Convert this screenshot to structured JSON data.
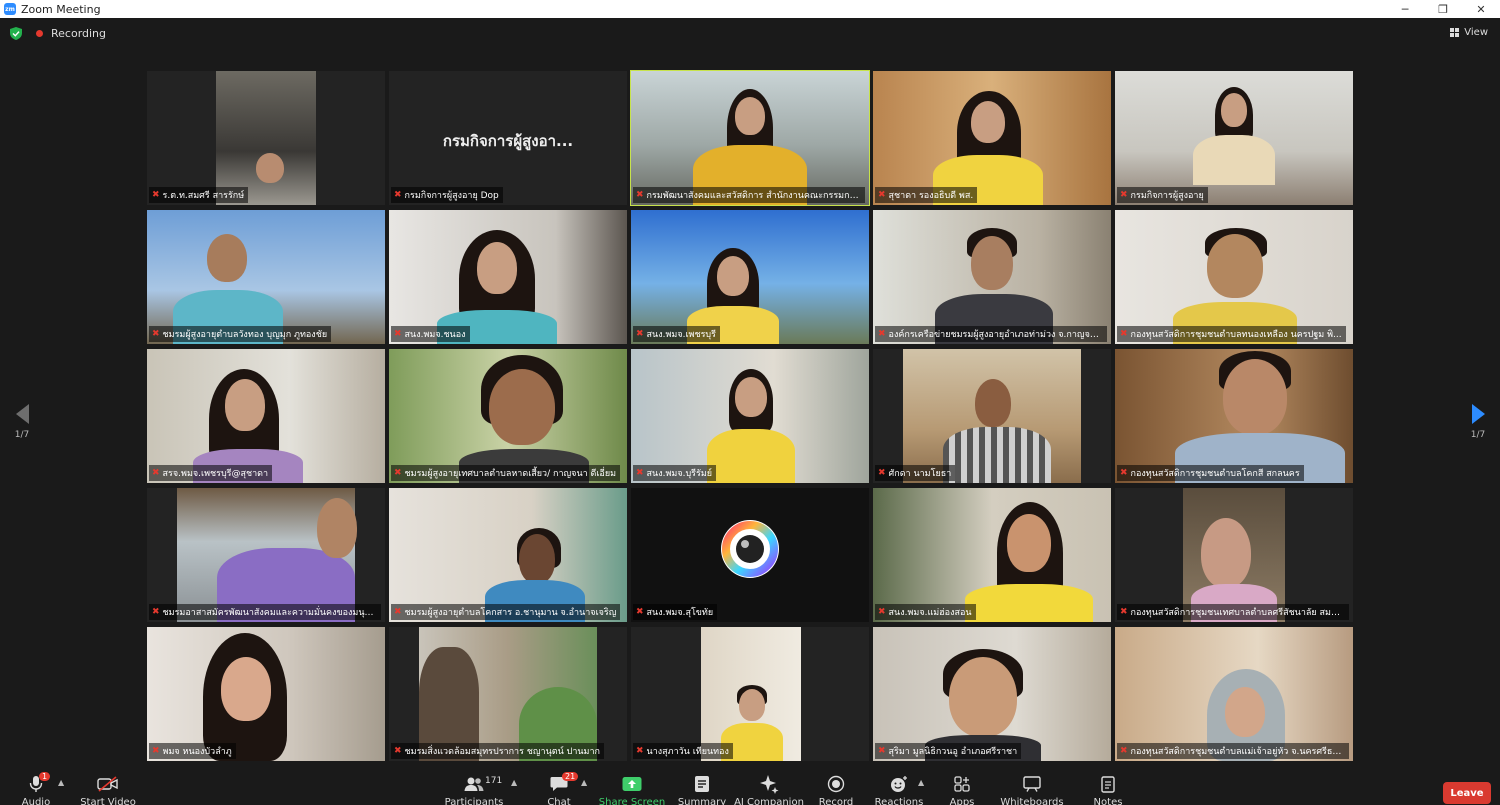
{
  "window": {
    "title": "Zoom Meeting",
    "minimize": "─",
    "maximize": "❐",
    "close": "✕"
  },
  "status": {
    "recording": "Recording",
    "view": "View"
  },
  "pager": {
    "left": "1/7",
    "right": "1/7"
  },
  "tiles": [
    "ร.ต.ท.สมศรี สารรักษ์",
    "กรมกิจการผู้สูงอายุ Dop",
    "กรมพัฒนาสังคมและสวัสดิการ สำนักงานคณะกรรมการส่งเ...",
    "สุชาดา รองอธิบดี พส.",
    "กรมกิจการผู้สูงอายุ",
    "ชมรมผู้สูงอายุตำบลวังทอง บุญมุก ภูทองชัย",
    "สนง.พมจ.ชนอง",
    "สนง.พมจ.เพชรบุรี",
    "องค์กรเครือข่ายชมรมผู้สูงอายุอำเภอท่าม่วง จ.กาญจนบุรี",
    "กองทุนสวัสดิการชุมชนตำบลทนองเหลือง นครปฐม พิ...",
    "สรจ.พมจ.เพชรบุรี@สุชาดา",
    "ชมรมผู้สูงอายุเทศบาลตำบลหาดเสี้ยว/ กาญจนา ดีเอี่ยม",
    "สนง.พมจ.บุรีรัมย์",
    "ศักดา นามโยธา",
    "กองทุนสวัสดิการชุมชนตำบลโคกสี สกลนคร",
    "ชมรมอาสาสมัครพัฒนาสังคมและความมั่นคงของมนุษย์ ...",
    "ชมรมผู้สูงอายุตำบลโคกสาร อ.ชานุมาน จ.อำนาจเจริญ",
    "สนง.พมจ.สุโขทัย",
    "สนง.พมจ.แม่ฮ่องสอน",
    "กองทุนสวัสดิการชุมชนเทศบาลตำบลศรีสัชนาลัย สมพร ผ...",
    "พมจ หนองบัวลำภู",
    "ชมรมสิ่งแวดล้อมสมุทรปราการ ชญานุตน์ ปานมาก",
    "นางสุภาวัน เทียนทอง",
    "สุริมา มูลนิธิกวนอู อำเภอศรีราชา",
    "กองทุนสวัสดิการชุมชนตำบลแม่เจ้าอยู่หัว จ.นครศรีธรรม..."
  ],
  "tile2_display": "กรมกิจการผู้สูงอา...",
  "toolbar": {
    "audio": "Audio",
    "start_video": "Start Video",
    "participants": "Participants",
    "participants_count": "171",
    "chat": "Chat",
    "chat_badge": "21",
    "audio_badge": "1",
    "share_screen": "Share Screen",
    "summary": "Summary",
    "ai_companion": "AI Companion",
    "record": "Record",
    "reactions": "Reactions",
    "apps": "Apps",
    "whiteboards": "Whiteboards",
    "notes": "Notes",
    "leave": "Leave"
  },
  "colors": {
    "accent": "#2D8CFF",
    "active_speaker": "#c7e34b",
    "leave": "#d93a30",
    "share": "#3fce6b",
    "muted": "#e5392e"
  }
}
